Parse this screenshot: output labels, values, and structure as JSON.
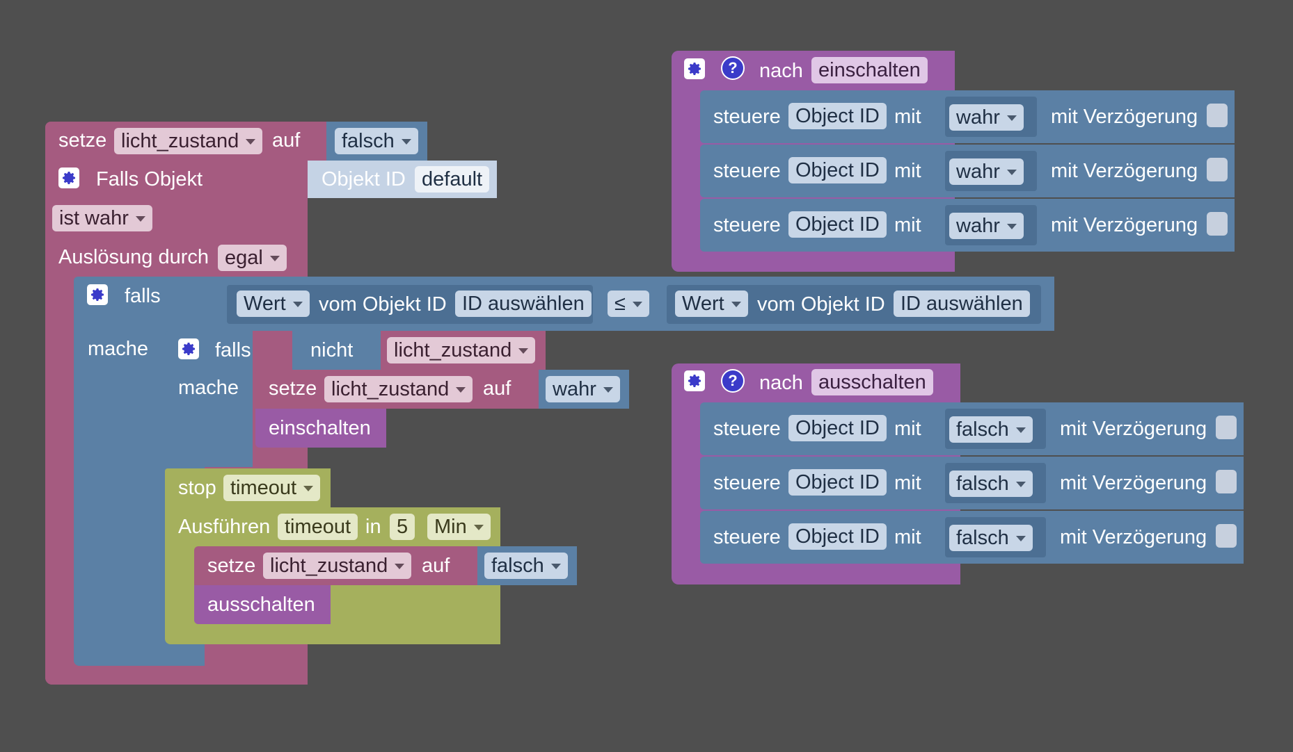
{
  "colors": {
    "background": "#4f4f4f",
    "variables": "#a55b80",
    "logic": "#5b80a5",
    "functions": "#995ba5",
    "timeouts": "#a5b05d"
  },
  "icons": {
    "gear": "gear-icon",
    "help": "question-icon"
  },
  "main": {
    "set1": {
      "keyword": "setze",
      "variable": "licht_zustand",
      "to": "auf",
      "value": "falsch"
    },
    "trigger": {
      "title": "Falls Objekt",
      "object_label": "Objekt ID",
      "object_value": "default",
      "condition": "ist wahr",
      "cause_label": "Auslösung durch",
      "cause_value": "egal"
    },
    "if1": {
      "keyword": "falls",
      "do": "mache",
      "left_field": "Wert",
      "left_of": "vom Objekt ID",
      "left_id": "ID auswählen",
      "operator": "≤",
      "right_field": "Wert",
      "right_of": "vom Objekt ID",
      "right_id": "ID auswählen"
    },
    "if2": {
      "keyword": "falls",
      "do": "mache",
      "not": "nicht",
      "variable": "licht_zustand",
      "set": {
        "keyword": "setze",
        "variable": "licht_zustand",
        "to": "auf",
        "value": "wahr"
      },
      "call": "einschalten"
    },
    "stop": {
      "keyword": "stop",
      "value": "timeout"
    },
    "run": {
      "keyword": "Ausführen",
      "name": "timeout",
      "in": "in",
      "amount": "5",
      "unit": "Min",
      "set": {
        "keyword": "setze",
        "variable": "licht_zustand",
        "to": "auf",
        "value": "falsch"
      },
      "call": "ausschalten"
    }
  },
  "func_on": {
    "keyword": "nach",
    "name": "einschalten",
    "rows": [
      {
        "keyword": "steuere",
        "object": "Object ID",
        "with": "mit",
        "value": "wahr",
        "delay": "mit Verzögerung"
      },
      {
        "keyword": "steuere",
        "object": "Object ID",
        "with": "mit",
        "value": "wahr",
        "delay": "mit Verzögerung"
      },
      {
        "keyword": "steuere",
        "object": "Object ID",
        "with": "mit",
        "value": "wahr",
        "delay": "mit Verzögerung"
      }
    ]
  },
  "func_off": {
    "keyword": "nach",
    "name": "ausschalten",
    "rows": [
      {
        "keyword": "steuere",
        "object": "Object ID",
        "with": "mit",
        "value": "falsch",
        "delay": "mit Verzögerung"
      },
      {
        "keyword": "steuere",
        "object": "Object ID",
        "with": "mit",
        "value": "falsch",
        "delay": "mit Verzögerung"
      },
      {
        "keyword": "steuere",
        "object": "Object ID",
        "with": "mit",
        "value": "falsch",
        "delay": "mit Verzögerung"
      }
    ]
  }
}
